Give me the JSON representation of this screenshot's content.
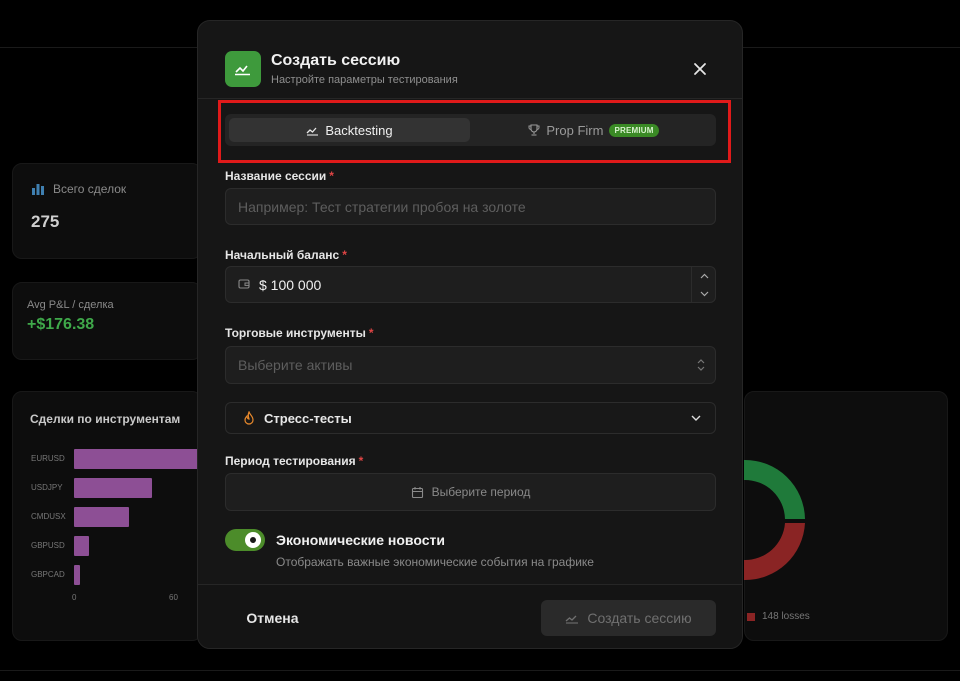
{
  "background": {
    "total_trades": {
      "label": "Всего сделок",
      "value": "275"
    },
    "avg_pnl": {
      "label": "Avg P&L / сделка",
      "value": "+$176.38"
    },
    "chart_data": {
      "type": "bar",
      "title": "Сделки по инструментам",
      "categories": [
        "EURUSD",
        "USDJPY",
        "CMDUSX",
        "GBPUSD",
        "GBPCAD"
      ],
      "values": [
        84,
        48,
        34,
        9,
        4
      ],
      "xticks": [
        "0",
        "60"
      ],
      "xlim": [
        0,
        60
      ]
    },
    "donut": {
      "losses_label": "148 losses",
      "loss_color": "#8a2424",
      "win_color": "#1f7a3a"
    }
  },
  "modal": {
    "title": "Создать сессию",
    "subtitle": "Настройте параметры тестирования",
    "tabs": [
      {
        "label": "Backtesting",
        "active": true
      },
      {
        "label": "Prop Firm",
        "badge": "PREMIUM",
        "active": false
      }
    ],
    "session_name": {
      "label": "Название сессии",
      "required": "*",
      "placeholder": "Например: Тест стратегии пробоя на золоте"
    },
    "initial_balance": {
      "label": "Начальный баланс",
      "required": "*",
      "value": "$ 100 000"
    },
    "instruments": {
      "label": "Торговые инструменты",
      "required": "*",
      "placeholder": "Выберите активы"
    },
    "stress_tests": {
      "label": "Стресс-тесты"
    },
    "period": {
      "label": "Период тестирования",
      "required": "*",
      "placeholder": "Выберите период"
    },
    "news": {
      "title": "Экономические новости",
      "subtitle": "Отображать важные экономические события на графике",
      "enabled": true
    },
    "footer": {
      "cancel": "Отмена",
      "create": "Создать сессию"
    }
  },
  "colors": {
    "accent": "#3e9a3c",
    "highlight": "#e01a1a",
    "bar": "#8d4f95"
  }
}
